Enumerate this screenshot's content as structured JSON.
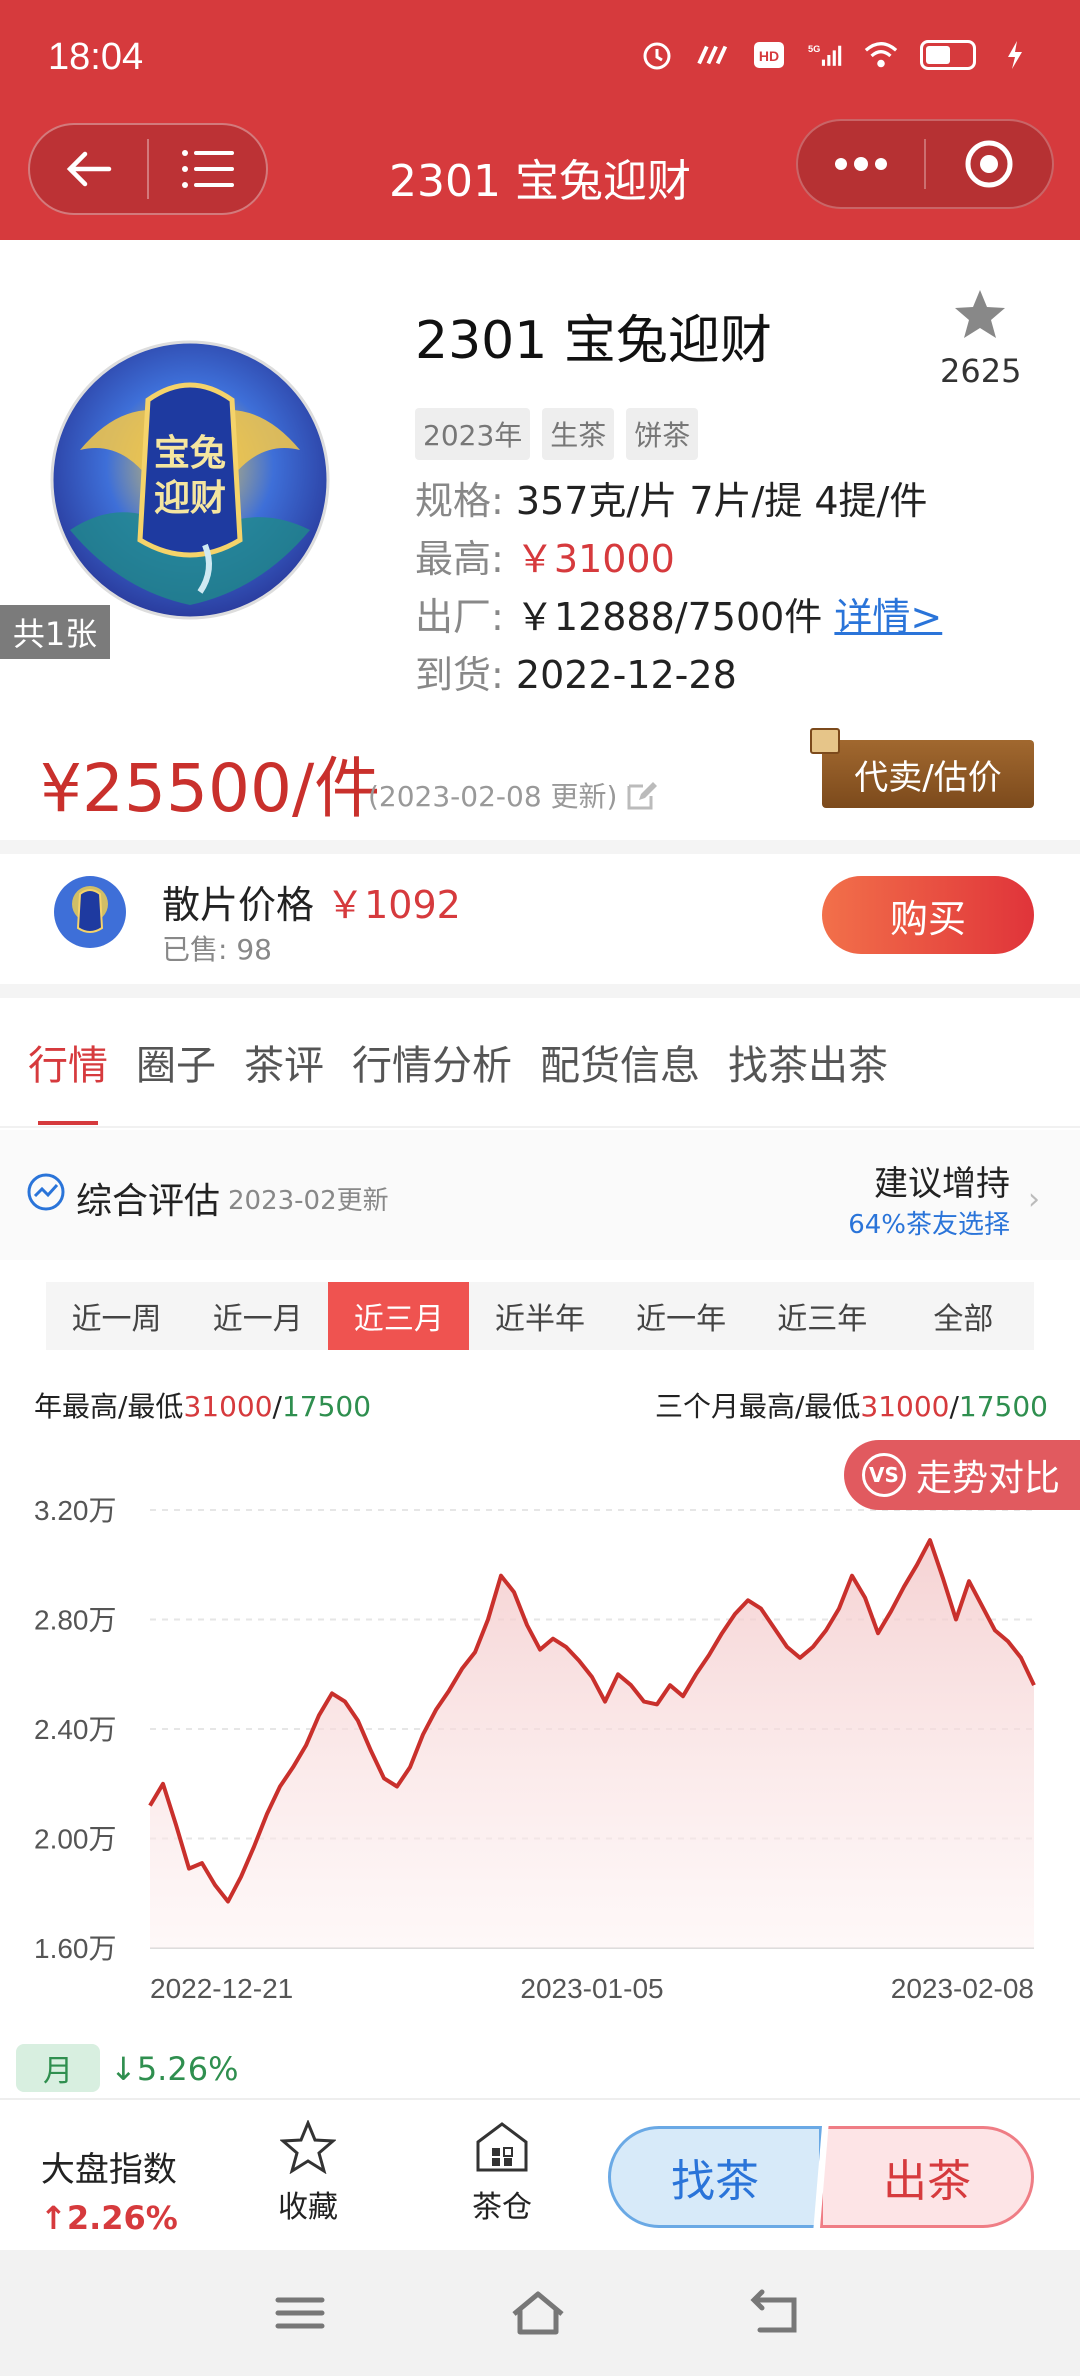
{
  "status": {
    "time": "18:04"
  },
  "nav": {
    "title": "2301 宝兔迎财"
  },
  "product": {
    "title": "2301 宝兔迎财",
    "favorite_count": "2625",
    "image_count": "共1张",
    "tags": [
      "2023年",
      "生茶",
      "饼茶"
    ],
    "spec_label": "规格:",
    "spec_value": "357克/片 7片/提 4提/件",
    "high_label": "最高:",
    "high_value": "￥31000",
    "factory_label": "出厂:",
    "factory_value": "￥12888/7500件",
    "factory_link": "详情>",
    "arrival_label": "到货:",
    "arrival_value": "2022-12-28",
    "price": "¥25500/件",
    "price_date": "(2023-02-08 更新)",
    "sell_button": "代卖/估价"
  },
  "loose": {
    "label": "散片价格",
    "price": "￥1092",
    "sold": "已售: 98",
    "buy_button": "购买"
  },
  "tabs": [
    "行情",
    "圈子",
    "茶评",
    "行情分析",
    "配货信息",
    "找茶出茶"
  ],
  "evaluation": {
    "title": "综合评估",
    "date": "2023-02更新",
    "recommendation": "建议增持",
    "percent": "64%茶友选择"
  },
  "periods": [
    "近一周",
    "近一月",
    "近三月",
    "近半年",
    "近一年",
    "近三年",
    "全部"
  ],
  "range": {
    "year_label": "年最高/最低",
    "year_high": "31000",
    "year_low": "17500",
    "sep": "/",
    "quarter_label": "三个月最高/最低",
    "quarter_high": "31000",
    "quarter_low": "17500"
  },
  "compare_button": {
    "badge": "VS",
    "label": "走势对比"
  },
  "chart_data": {
    "type": "area",
    "title": "",
    "xlabel": "",
    "ylabel": "",
    "ylim": [
      16000,
      32000
    ],
    "yticks": [
      "3.20万",
      "2.80万",
      "2.40万",
      "2.00万",
      "1.60万"
    ],
    "ytick_values": [
      32000,
      28000,
      24000,
      20000,
      16000
    ],
    "xticks": [
      "2022-12-21",
      "2023-01-05",
      "2023-02-08"
    ],
    "series": [
      {
        "color": "#c9302c",
        "values": [
          21200,
          22000,
          20500,
          18900,
          19100,
          18300,
          17700,
          18600,
          19700,
          20900,
          21900,
          22600,
          23400,
          24500,
          25300,
          25000,
          24300,
          23200,
          22200,
          21900,
          22600,
          23800,
          24700,
          25400,
          26200,
          26800,
          28000,
          29600,
          29000,
          27800,
          26900,
          27300,
          27000,
          26500,
          25900,
          25000,
          26000,
          25600,
          25000,
          24900,
          25600,
          25200,
          26000,
          26700,
          27500,
          28200,
          28700,
          28400,
          27700,
          27000,
          26600,
          27000,
          27600,
          28400,
          29600,
          28800,
          27500,
          28300,
          29200,
          30000,
          30900,
          29500,
          28000,
          29400,
          28500,
          27600,
          27200,
          26600,
          25600
        ]
      }
    ]
  },
  "month": {
    "label": "月",
    "change": "↓5.26%"
  },
  "bottom": {
    "index_label": "大盘指数",
    "index_value": "↑2.26%",
    "favorite": "收藏",
    "warehouse": "茶仓",
    "find": "找茶",
    "out": "出茶"
  },
  "icons": {
    "back": "back-arrow-icon",
    "menu": "menu-icon",
    "more": "more-dots-icon",
    "close": "target-icon",
    "star": "star-icon",
    "edit": "edit-icon",
    "warehouse": "warehouse-icon"
  }
}
